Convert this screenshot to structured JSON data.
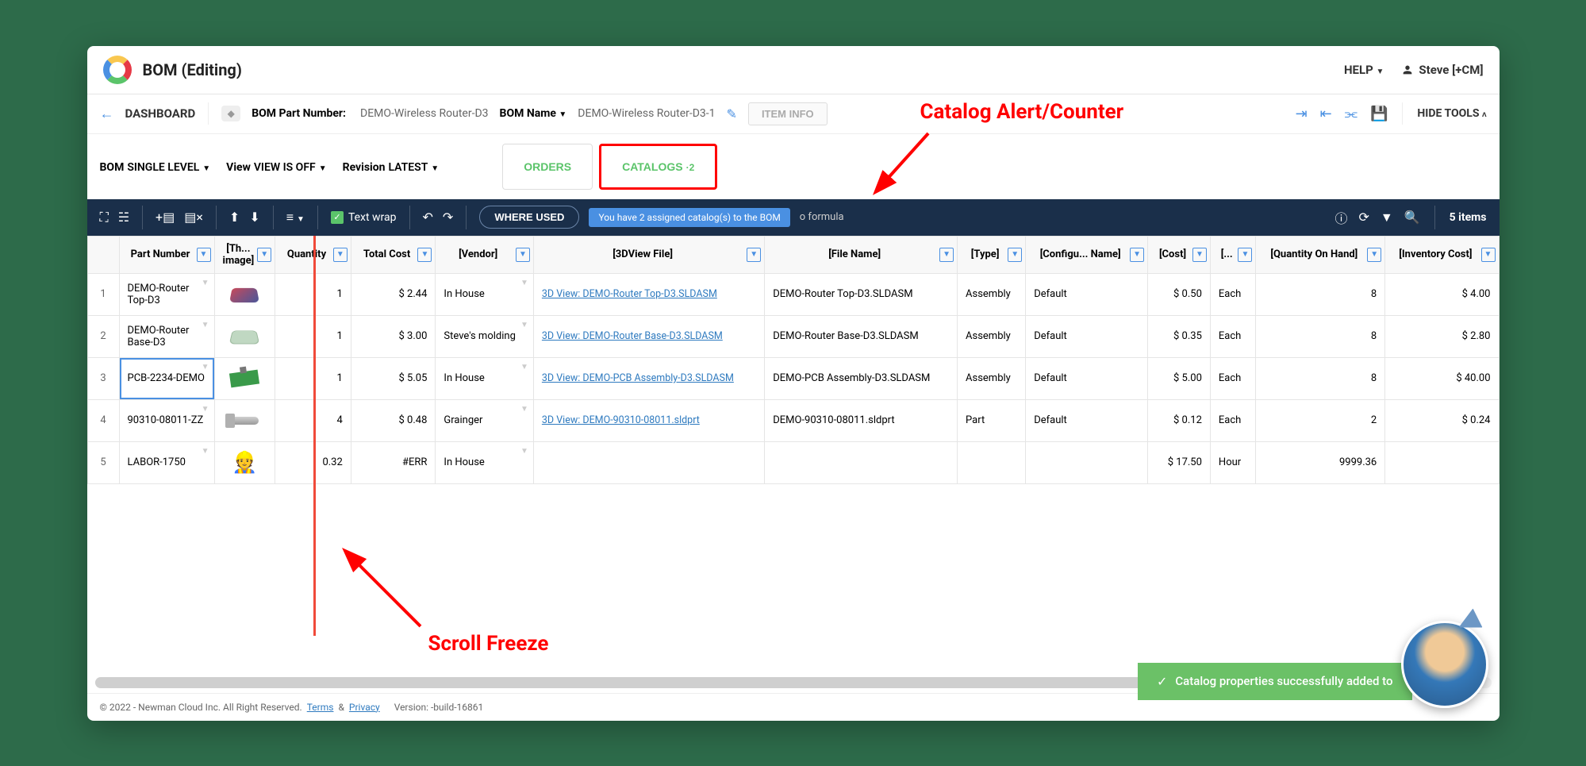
{
  "header": {
    "title": "BOM (Editing)",
    "help": "HELP",
    "user": "Steve [+CM]"
  },
  "nav": {
    "dashboard": "DASHBOARD",
    "bom_pn_label": "BOM Part Number:",
    "bom_pn_value": "DEMO-Wireless Router-D3",
    "bom_name_label": "BOM Name",
    "bom_name_value": "DEMO-Wireless Router-D3-1",
    "item_info": "ITEM INFO",
    "hide_tools": "HIDE TOOLS"
  },
  "filters": {
    "bom_label": "BOM",
    "bom_value": "SINGLE LEVEL",
    "view_label": "View",
    "view_value": "VIEW IS OFF",
    "rev_label": "Revision",
    "rev_value": "LATEST",
    "orders_tab": "ORDERS",
    "catalogs_tab": "CATALOGS",
    "catalogs_count": "2"
  },
  "toolbar": {
    "text_wrap": "Text wrap",
    "where_used": "WHERE USED",
    "tooltip": "You have 2 assigned catalog(s) to the BOM",
    "formula": "o formula",
    "items_count": "5 items"
  },
  "annotations": {
    "catalog": "Catalog Alert/Counter",
    "scroll": "Scroll Freeze"
  },
  "columns": [
    "Part Number",
    "[Th... image]",
    "Quantity",
    "Total Cost",
    "[Vendor]",
    "[3DView File]",
    "[File Name]",
    "[Type]",
    "[Configu... Name]",
    "[Cost]",
    "[...",
    "[Quantity On Hand]",
    "[Inventory Cost]"
  ],
  "rows": [
    {
      "n": "1",
      "pn": "DEMO-Router Top-D3",
      "qty": "1",
      "total": "$ 2.44",
      "vendor": "In House",
      "link": "3D View: DEMO-Router Top-D3.SLDASM",
      "file": "DEMO-Router Top-D3.SLDASM",
      "type": "Assembly",
      "cfg": "Default",
      "cost": "$ 0.50",
      "uom": "Each",
      "qoh": "8",
      "inv": "$ 4.00",
      "shape": "router-top"
    },
    {
      "n": "2",
      "pn": "DEMO-Router Base-D3",
      "qty": "1",
      "total": "$ 3.00",
      "vendor": "Steve's molding",
      "link": "3D View: DEMO-Router Base-D3.SLDASM",
      "file": "DEMO-Router Base-D3.SLDASM",
      "type": "Assembly",
      "cfg": "Default",
      "cost": "$ 0.35",
      "uom": "Each",
      "qoh": "8",
      "inv": "$ 2.80",
      "shape": "router-base"
    },
    {
      "n": "3",
      "pn": "PCB-2234-DEMO",
      "qty": "1",
      "total": "$ 5.05",
      "vendor": "In House",
      "link": "3D View: DEMO-PCB Assembly-D3.SLDASM",
      "file": "DEMO-PCB Assembly-D3.SLDASM",
      "type": "Assembly",
      "cfg": "Default",
      "cost": "$ 5.00",
      "uom": "Each",
      "qoh": "8",
      "inv": "$ 40.00",
      "shape": "pcb",
      "hl": true
    },
    {
      "n": "4",
      "pn": "90310-08011-ZZ",
      "qty": "4",
      "total": "$ 0.48",
      "vendor": "Grainger",
      "link": "3D View: DEMO-90310-08011.sldprt",
      "file": "DEMO-90310-08011.sldprt",
      "type": "Part",
      "cfg": "Default",
      "cost": "$ 0.12",
      "uom": "Each",
      "qoh": "2",
      "inv": "$ 0.24",
      "shape": "bolt"
    },
    {
      "n": "5",
      "pn": "LABOR-1750",
      "qty": "0.32",
      "total": "#ERR",
      "vendor": "In House",
      "link": "",
      "file": "",
      "type": "",
      "cfg": "",
      "cost": "$ 17.50",
      "uom": "Hour",
      "qoh": "9999.36",
      "inv": "",
      "shape": "worker"
    }
  ],
  "footer": {
    "copyright": "© 2022 - Newman Cloud Inc. All Right Reserved.",
    "terms": "Terms",
    "amp": "&",
    "privacy": "Privacy",
    "version": "Version: -build-16861"
  },
  "toast": {
    "message": "Catalog properties successfully added to"
  }
}
